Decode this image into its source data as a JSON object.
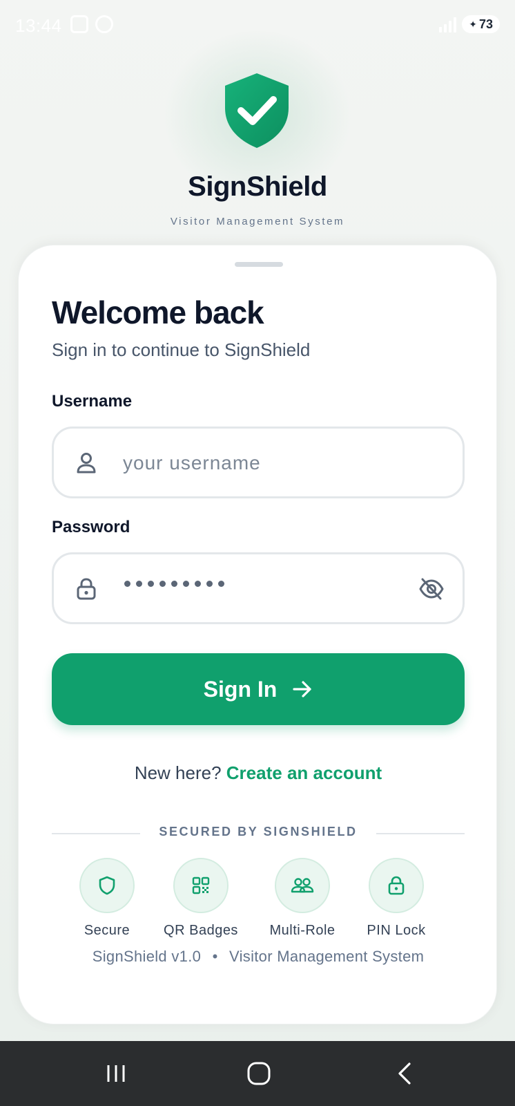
{
  "status_bar": {
    "time": "13:44",
    "battery": "73"
  },
  "app": {
    "title": "SignShield",
    "subtitle": "Visitor Management System"
  },
  "login": {
    "title": "Welcome back",
    "subtitle": "Sign in to continue to SignShield",
    "username_label": "Username",
    "username_placeholder": "your username",
    "password_label": "Password",
    "password_masked": "•••••••••",
    "submit_label": "Sign In",
    "signup_prompt": "New here?",
    "signup_link": "Create an account"
  },
  "security": {
    "heading": "SECURED BY SIGNSHIELD",
    "features": [
      {
        "label": "Secure",
        "icon": "shield-icon"
      },
      {
        "label": "QR Badges",
        "icon": "qr-code-icon"
      },
      {
        "label": "Multi-Role",
        "icon": "users-icon"
      },
      {
        "label": "PIN Lock",
        "icon": "lock-icon"
      }
    ]
  },
  "footer": {
    "version": "SignShield v1.0",
    "separator": "•",
    "system": "Visitor Management System"
  },
  "colors": {
    "brand_green": "#10a06d",
    "title_text": "#0f172a",
    "muted_text": "#64748b"
  }
}
